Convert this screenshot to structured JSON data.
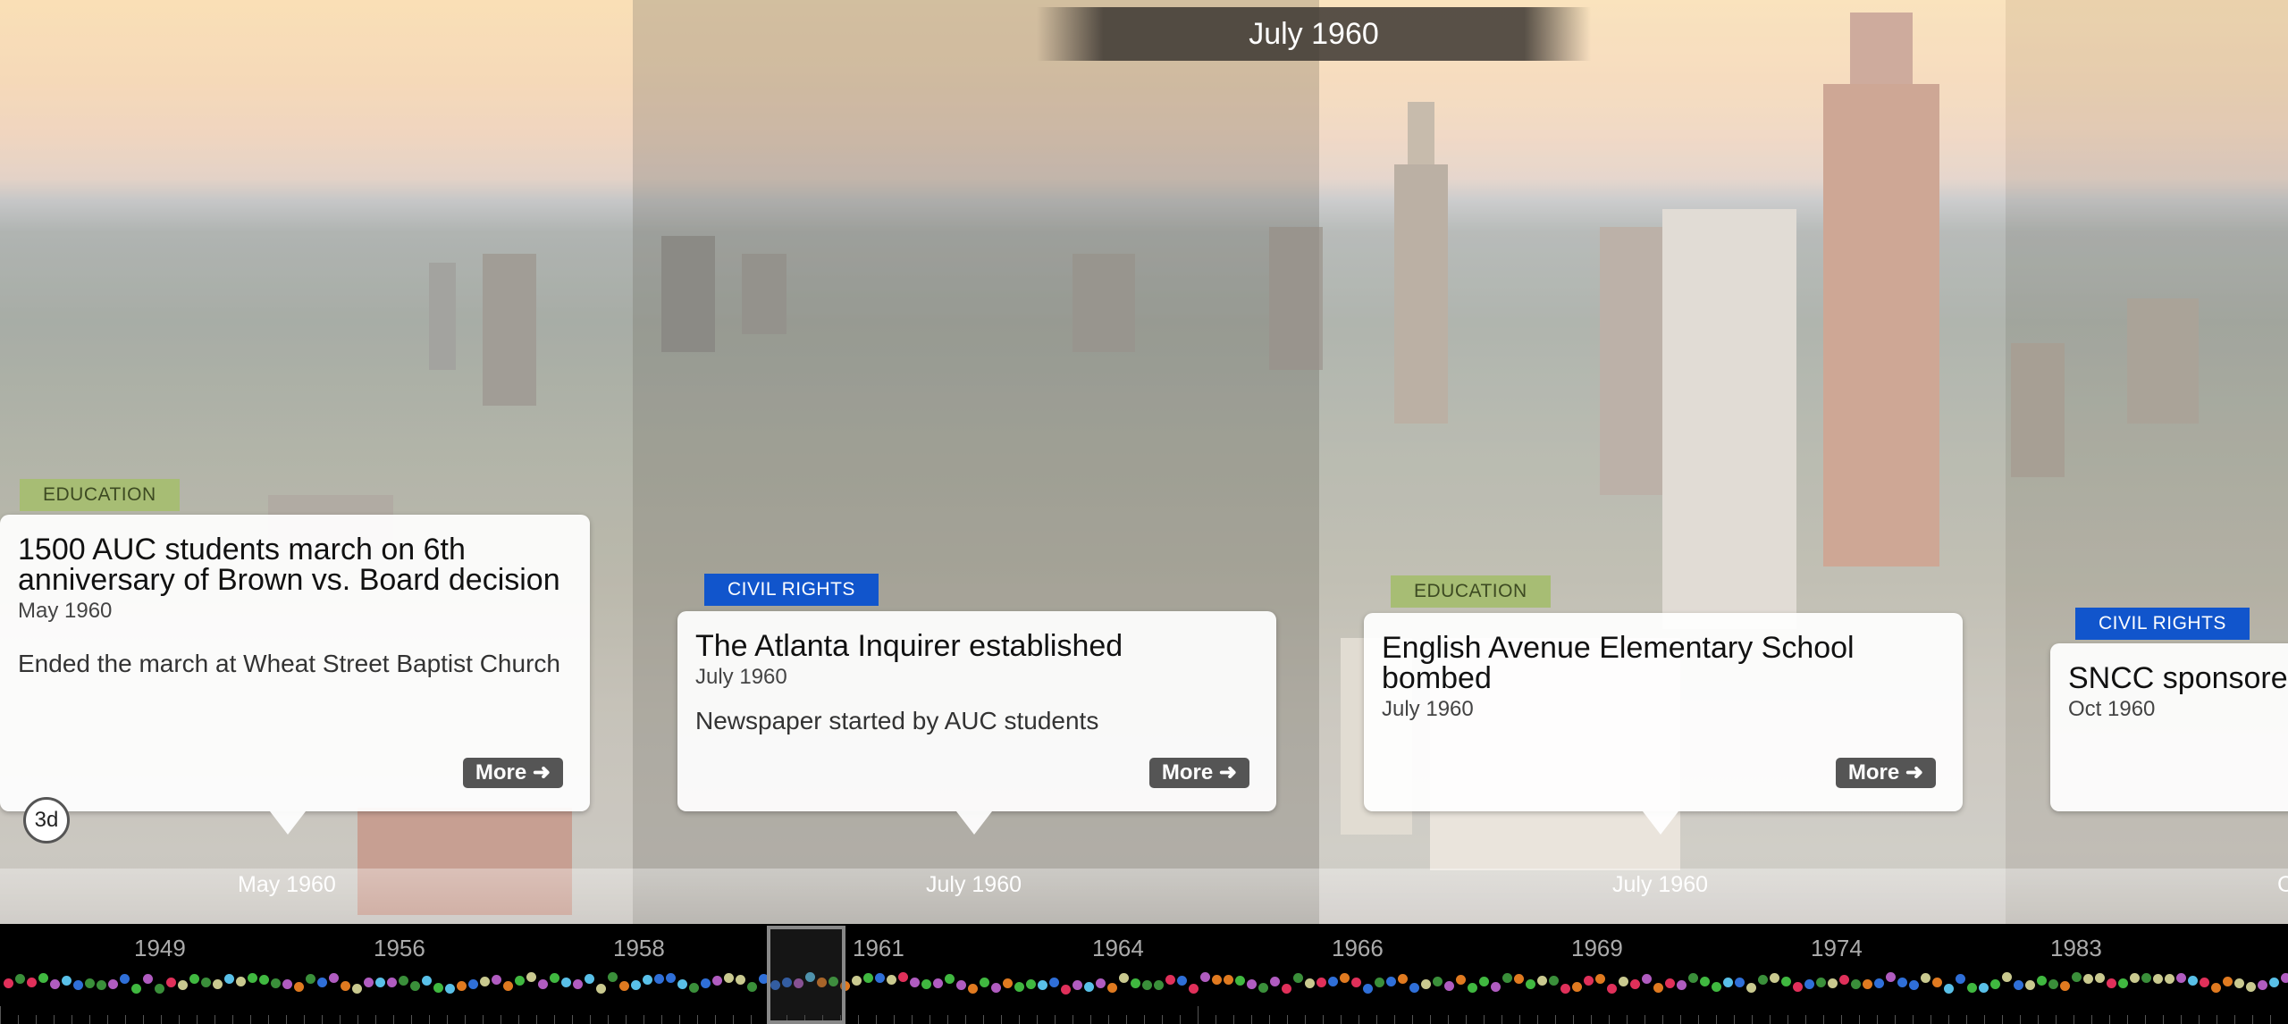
{
  "header": {
    "title": "July 1960"
  },
  "events": [
    {
      "tag": "EDUCATION",
      "title": "1500 AUC students march on 6th anniversary of Brown vs. Board decision",
      "date": "May 1960",
      "description": "Ended the march at Wheat Street Baptist Church",
      "more_label": "More"
    },
    {
      "tag": "CIVIL RIGHTS",
      "title": "The Atlanta Inquirer established",
      "date": "July 1960",
      "description": "Newspaper started by AUC students",
      "more_label": "More"
    },
    {
      "tag": "EDUCATION",
      "title": "English Avenue Elementary School bombed",
      "date": "July 1960",
      "description": "",
      "more_label": "More"
    },
    {
      "tag": "CIVIL RIGHTS",
      "title": "SNCC sponsore",
      "date": "Oct 1960",
      "description": "",
      "more_label": ""
    }
  ],
  "timebar_labels": [
    "May 1960",
    "July 1960",
    "July 1960",
    "C"
  ],
  "badge": "3d",
  "navigator": {
    "years": [
      "1949",
      "1956",
      "1958",
      "1961",
      "1964",
      "1966",
      "1969",
      "1974",
      "1983"
    ]
  },
  "colors": {
    "education": "#a7bd74",
    "civil_rights": "#1155cc"
  }
}
